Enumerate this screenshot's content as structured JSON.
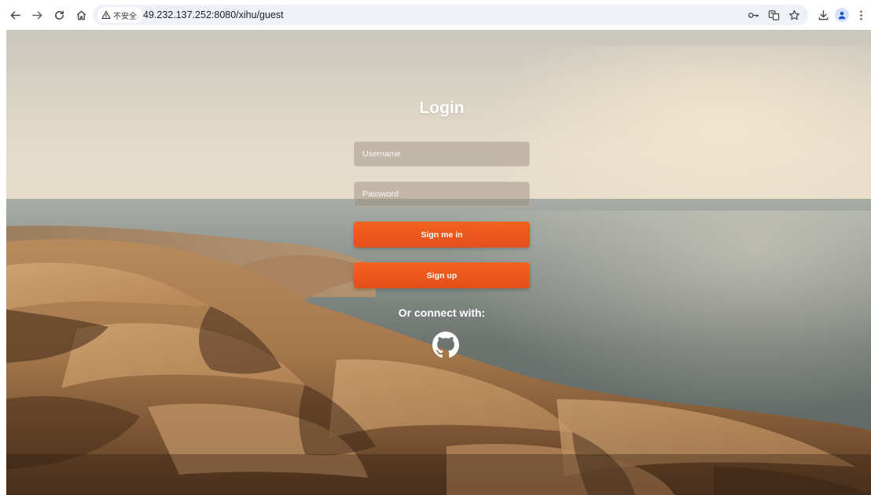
{
  "browser": {
    "security_label": "不安全",
    "url": "49.232.137.252:8080/xihu/guest"
  },
  "icons": {
    "back": "arrow-left-icon",
    "forward": "arrow-right-icon",
    "reload": "reload-icon",
    "home": "home-icon",
    "warning": "warning-triangle-icon",
    "password_key": "key-icon",
    "translate": "translate-icon",
    "bookmark": "star-icon",
    "downloads": "download-icon",
    "profile": "person-icon",
    "menu": "kebab-menu-icon",
    "github": "github-icon"
  },
  "login": {
    "title": "Login",
    "username_placeholder": "Username",
    "username_value": "",
    "password_placeholder": "Password",
    "password_value": "",
    "sign_in_label": "Sign me in",
    "sign_up_label": "Sign up",
    "connect_text": "Or connect with:"
  },
  "colors": {
    "accent": "#f05a1e",
    "title_text": "#ffffff"
  }
}
